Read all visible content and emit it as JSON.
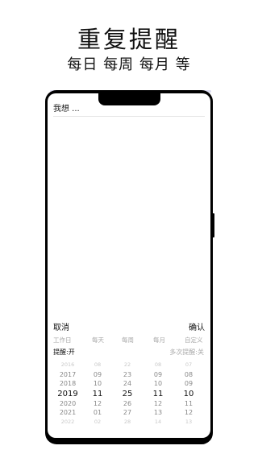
{
  "headline": "重复提醒",
  "subline": "每日 每周 每月 等",
  "note_placeholder": "我想 ...",
  "actions": {
    "cancel": "取消",
    "confirm": "确认"
  },
  "repeat_options": [
    "工作日",
    "每天",
    "每周",
    "每月",
    "自定义"
  ],
  "reminder": {
    "toggle": "提醒:开",
    "multi": "多次提醒:关"
  },
  "picker": {
    "year": [
      "2016",
      "2017",
      "2018",
      "2019",
      "2020",
      "2021",
      "2022"
    ],
    "month": [
      "08",
      "09",
      "10",
      "11",
      "12",
      "01",
      "02"
    ],
    "day": [
      "22",
      "23",
      "24",
      "25",
      "26",
      "27",
      "28"
    ],
    "hour": [
      "08",
      "09",
      "10",
      "11",
      "12",
      "13",
      "14"
    ],
    "minute": [
      "07",
      "08",
      "09",
      "10",
      "11",
      "12",
      "13"
    ],
    "selected_index": 3
  }
}
